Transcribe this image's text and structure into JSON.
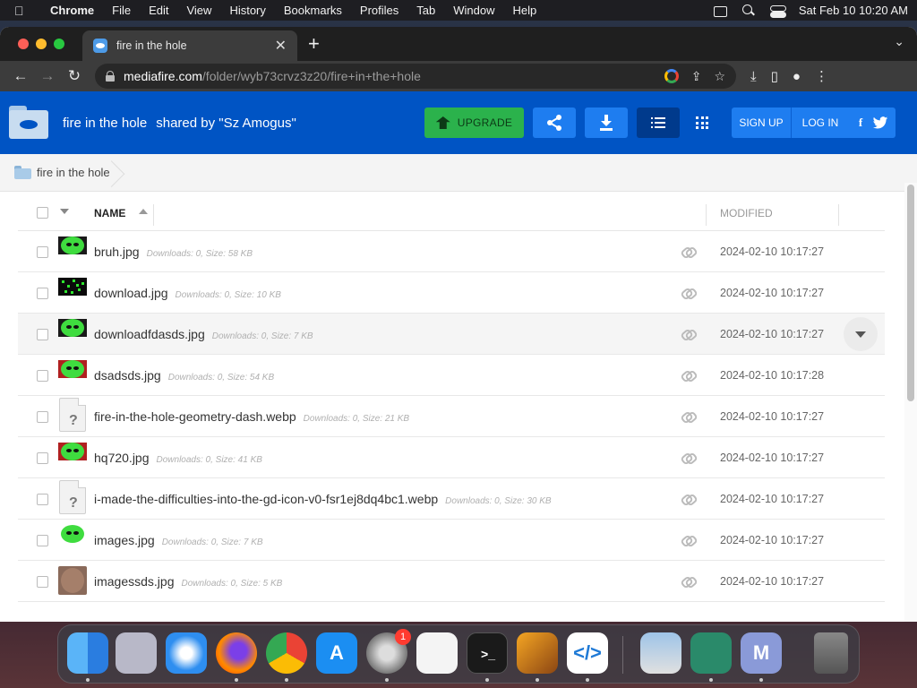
{
  "menubar": {
    "app": "Chrome",
    "items": [
      "File",
      "Edit",
      "View",
      "History",
      "Bookmarks",
      "Profiles",
      "Tab",
      "Window",
      "Help"
    ],
    "datetime": "Sat Feb 10  10:20 AM"
  },
  "browser": {
    "tab_title": "fire in the hole",
    "url_domain": "mediafire.com",
    "url_path": "/folder/wyb73crvz3z20/fire+in+the+hole"
  },
  "header": {
    "folder_name": "fire in the hole",
    "shared_by": "shared by \"Sz Amogus\"",
    "upgrade_label": "UPGRADE",
    "signup_label": "SIGN UP",
    "login_label": "LOG IN",
    "facebook_glyph": "f",
    "twitter_glyph": "t"
  },
  "breadcrumb": {
    "folder": "fire in the hole"
  },
  "table": {
    "name_header": "NAME",
    "modified_header": "MODIFIED",
    "rows": [
      {
        "name": "bruh.jpg",
        "meta": "Downloads: 0, Size: 58 KB",
        "modified": "2024-02-10 10:17:27",
        "thumb": "green-black"
      },
      {
        "name": "download.jpg",
        "meta": "Downloads: 0, Size: 10 KB",
        "modified": "2024-02-10 10:17:27",
        "thumb": "matrix"
      },
      {
        "name": "downloadfdasds.jpg",
        "meta": "Downloads: 0, Size: 7 KB",
        "modified": "2024-02-10 10:17:27",
        "thumb": "green-black"
      },
      {
        "name": "dsadsds.jpg",
        "meta": "Downloads: 0, Size: 54 KB",
        "modified": "2024-02-10 10:17:28",
        "thumb": "green-red"
      },
      {
        "name": "fire-in-the-hole-geometry-dash.webp",
        "meta": "Downloads: 0, Size: 21 KB",
        "modified": "2024-02-10 10:17:27",
        "thumb": "unknown"
      },
      {
        "name": "hq720.jpg",
        "meta": "Downloads: 0, Size: 41 KB",
        "modified": "2024-02-10 10:17:27",
        "thumb": "green-red"
      },
      {
        "name": "i-made-the-difficulties-into-the-gd-icon-v0-fsr1ej8dq4bc1.webp",
        "meta": "Downloads: 0, Size: 30 KB",
        "modified": "2024-02-10 10:17:27",
        "thumb": "unknown"
      },
      {
        "name": "images.jpg",
        "meta": "Downloads: 0, Size: 7 KB",
        "modified": "2024-02-10 10:17:27",
        "thumb": "green-black"
      },
      {
        "name": "imagessds.jpg",
        "meta": "Downloads: 0, Size: 5 KB",
        "modified": "2024-02-10 10:17:27",
        "thumb": "brown"
      }
    ]
  },
  "dock": {
    "settings_badge": "1",
    "apps": [
      "finder",
      "launchpad",
      "safari",
      "firefox",
      "chrome",
      "app-store",
      "system-settings",
      "textedit",
      "terminal",
      "garageband",
      "vscode",
      "preview",
      "files",
      "m-app",
      "trash"
    ]
  },
  "colors": {
    "mediafire_blue": "#0054c4",
    "upgrade_green": "#2bb24c",
    "button_blue": "#1e7df0"
  }
}
